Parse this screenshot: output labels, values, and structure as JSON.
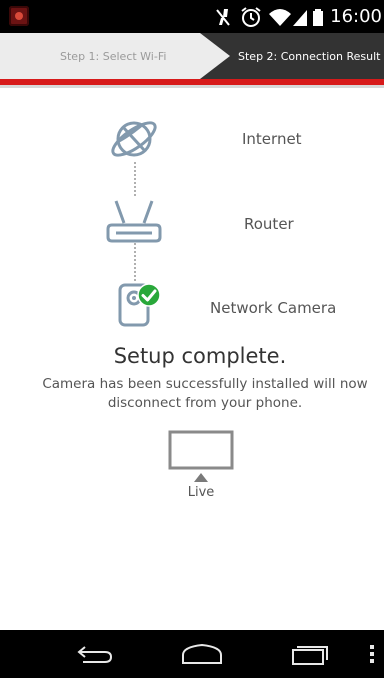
{
  "status_bar": {
    "time": "16:00",
    "icons": [
      "app-icon",
      "mute-icon",
      "alarm-icon",
      "wifi-icon",
      "signal-icon",
      "battery-icon"
    ]
  },
  "steps": {
    "step1_label": "Step 1: Select Wi-Fi",
    "step2_label": "Step 2: Connection Result"
  },
  "diagram": {
    "internet_label": "Internet",
    "router_label": "Router",
    "camera_label": "Network Camera"
  },
  "result": {
    "title": "Setup complete.",
    "message": "Camera has been successfully installed will now disconnect from your phone."
  },
  "live": {
    "label": "Live"
  },
  "nav_bar": {
    "icons": [
      "back-icon",
      "home-icon",
      "recent-apps-icon",
      "overflow-menu-icon"
    ]
  },
  "colors": {
    "accent_red": "#d71a1a",
    "success_green": "#29a83a",
    "icon_blue_grey": "#7f95aa"
  }
}
